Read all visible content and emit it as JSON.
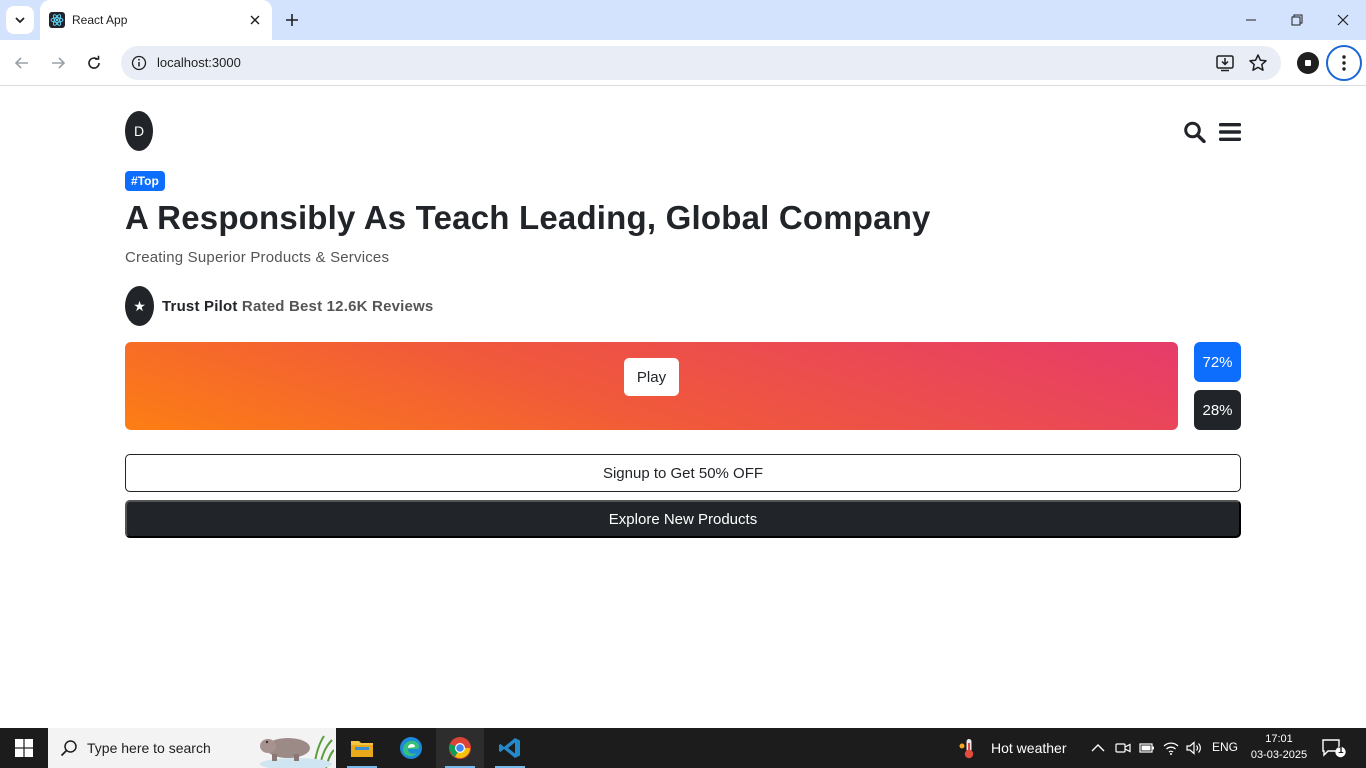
{
  "browser": {
    "tab_title": "React App",
    "url": "localhost:3000"
  },
  "page": {
    "logo_letter": "D",
    "badge": "#Top",
    "headline": "A Responsibly As Teach Leading, Global Company",
    "subheadline": "Creating Superior Products & Services",
    "trust": {
      "icon": "★",
      "brand": "Trust Pilot",
      "text": "Rated Best 12.6K Reviews"
    },
    "hero": {
      "play_label": "Play"
    },
    "stats": [
      "72%",
      "28%"
    ],
    "signup_label": "Signup to Get 50% OFF",
    "explore_label": "Explore New Products"
  },
  "taskbar": {
    "search_placeholder": "Type here to search",
    "weather": "Hot weather",
    "language": "ENG",
    "time": "17:01",
    "date": "03-03-2025",
    "notification_count": "1"
  },
  "colors": {
    "primary": "#0d6efd",
    "dark": "#212529",
    "hero_gradient_start": "#fd7e14",
    "hero_gradient_end": "#e63b6b"
  }
}
